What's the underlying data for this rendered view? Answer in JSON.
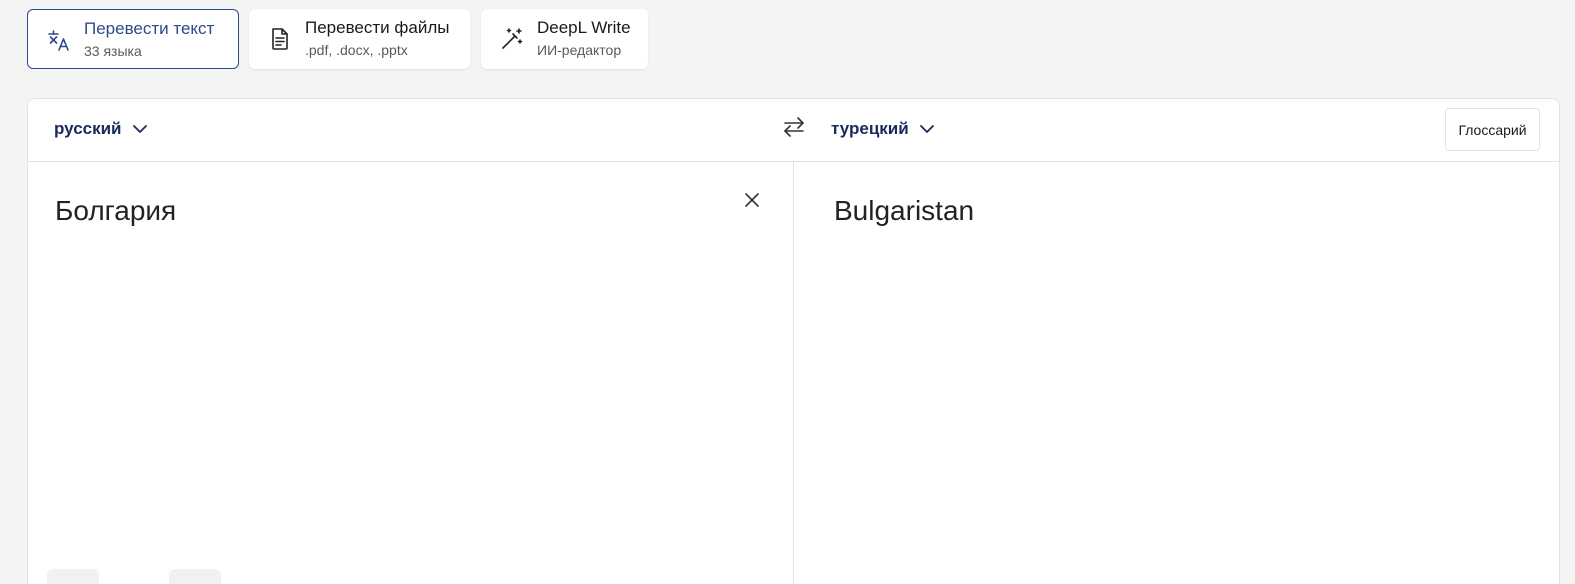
{
  "modes": [
    {
      "title": "Перевести текст",
      "subtitle": "33 языка",
      "icon": "translate-icon",
      "active": true
    },
    {
      "title": "Перевести файлы",
      "subtitle": ".pdf, .docx, .pptx",
      "icon": "document-icon",
      "active": false
    },
    {
      "title": "DeepL Write",
      "subtitle": "ИИ-редактор",
      "icon": "magic-wand-icon",
      "active": false
    }
  ],
  "translator": {
    "source_language": "русский",
    "target_language": "турецкий",
    "glossary_label": "Глоссарий",
    "source_text": "Болгария",
    "target_text": "Bulgaristan"
  },
  "colors": {
    "accent": "#2e4a8c",
    "language_text": "#1b2a5a",
    "background": "#f4f4f4"
  }
}
